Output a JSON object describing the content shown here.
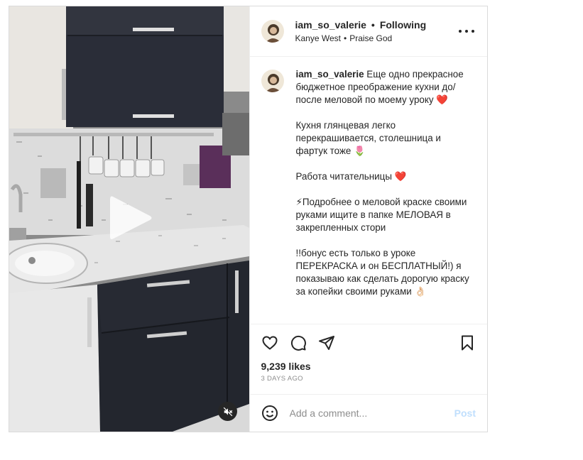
{
  "post": {
    "username": "iam_so_valerie",
    "separator": "•",
    "following_label": "Following",
    "music_artist": "Kanye West",
    "music_separator": "•",
    "music_title": "Praise God",
    "more_icon": "more-horizontal-icon"
  },
  "caption": {
    "username": "iam_so_valerie",
    "line1": "Еще одно прекрасное бюджетное преображение кухни до/после меловой по моему уроку ❤️",
    "line2": "Кухня глянцевая легко перекрашивается, столешница и фартук тоже 🌷",
    "line3": "Работа читательницы ❤️",
    "line4": "⚡Подробнее о меловой краске своими руками ищите в папке МЕЛОВАЯ в закрепленных стори",
    "line5": "!!бонус есть только в уроке ПЕРЕКРАСКА и он БЕСПЛАТНЫЙ!) я показываю как сделать дорогую краску за копейки своими руками 👌🏻"
  },
  "actions": {
    "like_icon": "heart-icon",
    "comment_icon": "comment-icon",
    "share_icon": "paper-plane-icon",
    "save_icon": "bookmark-icon"
  },
  "stats": {
    "likes": "9,239 likes",
    "time": "3 DAYS AGO"
  },
  "comment_box": {
    "emoji_icon": "smiley-icon",
    "placeholder": "Add a comment...",
    "post_label": "Post"
  },
  "media": {
    "type": "video",
    "play_icon": "play-icon",
    "mute_icon": "speaker-muted-icon"
  },
  "colors": {
    "text": "#262626",
    "muted": "#8e8e8e",
    "border": "#dbdbdb",
    "post_button_disabled": "#c0dffd",
    "heart_red": "#ed4956"
  }
}
